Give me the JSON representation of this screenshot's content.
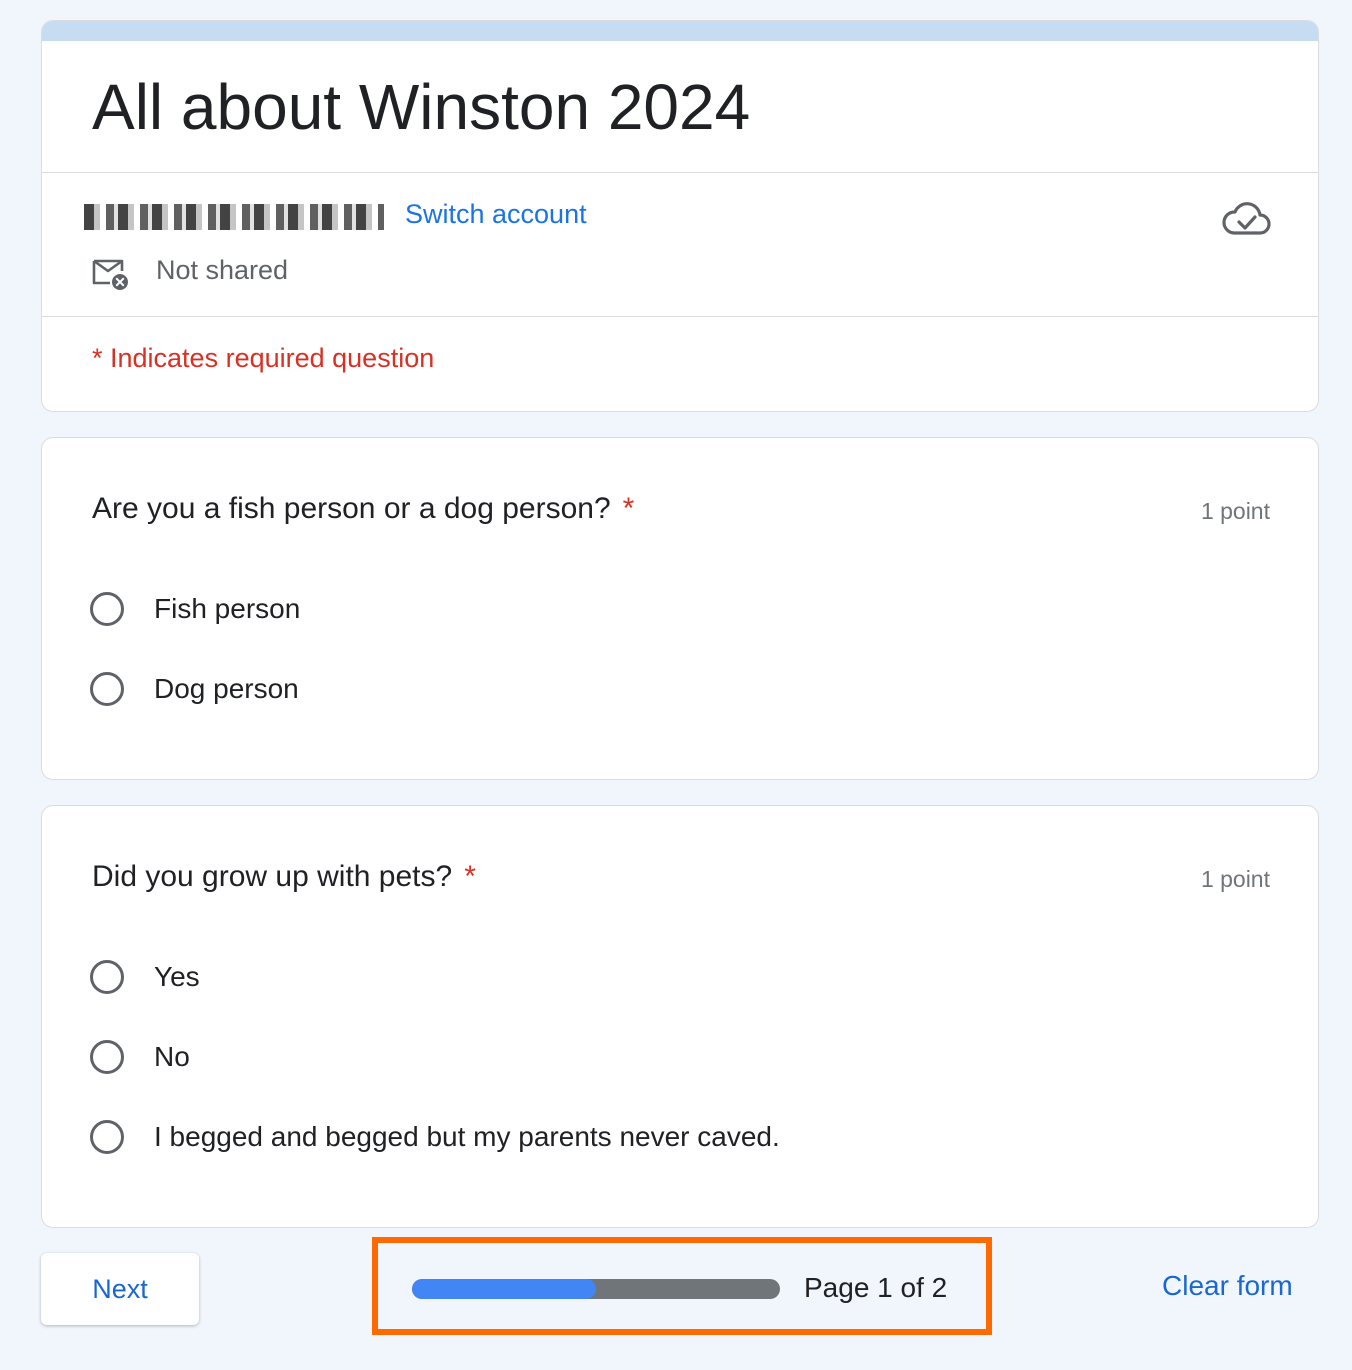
{
  "form": {
    "title": "All about Winston 2024",
    "switch_account": "Switch account",
    "not_shared": "Not shared",
    "required_note": "* Indicates required question"
  },
  "questions": [
    {
      "title": "Are you a fish person or a dog person?",
      "required_mark": "*",
      "points": "1 point",
      "options": [
        "Fish person",
        "Dog person"
      ]
    },
    {
      "title": "Did you grow up with pets?",
      "required_mark": "*",
      "points": "1 point",
      "options": [
        "Yes",
        "No",
        "I begged and begged but my parents never caved."
      ]
    }
  ],
  "footer": {
    "next_label": "Next",
    "progress_fraction": 0.5,
    "page_text": "Page 1 of 2",
    "clear_label": "Clear form"
  },
  "colors": {
    "accent_blue": "#1a73e8",
    "required_red": "#d93025",
    "progress_fill": "#4285f4",
    "highlight_border": "#ff6a00"
  },
  "icons": [
    "cloud-check-icon",
    "mail-not-shared-icon"
  ]
}
